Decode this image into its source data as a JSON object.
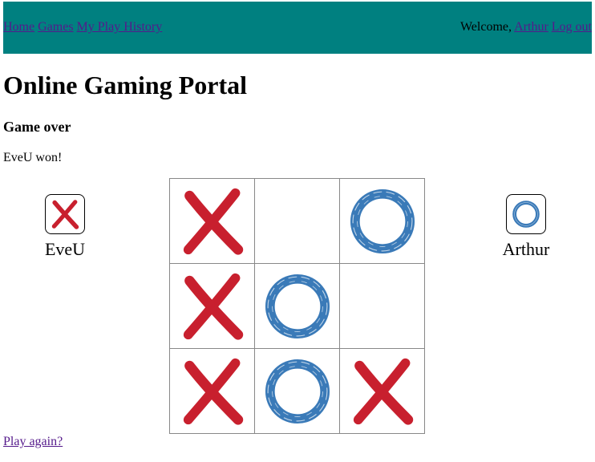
{
  "nav": {
    "links": [
      "Home",
      "Games",
      "My Play History"
    ],
    "welcome_text": "Welcome,",
    "user_link": "Arthur",
    "logout_link": "Log out"
  },
  "page_title": "Online Gaming Portal",
  "status_heading": "Game over",
  "result_text": "EveU won!",
  "players": {
    "left": {
      "name": "EveU",
      "token": "x-mark-icon"
    },
    "right": {
      "name": "Arthur",
      "token": "o-mark-icon"
    }
  },
  "board": {
    "cells": [
      "X",
      "",
      "O",
      "X",
      "O",
      "",
      "X",
      "O",
      "X"
    ]
  },
  "play_again": "Play again?",
  "colors": {
    "nav_background": "#008080",
    "x_color": "#c8202e",
    "o_color": "#3a7ab8",
    "link_color": "#551a8b"
  }
}
